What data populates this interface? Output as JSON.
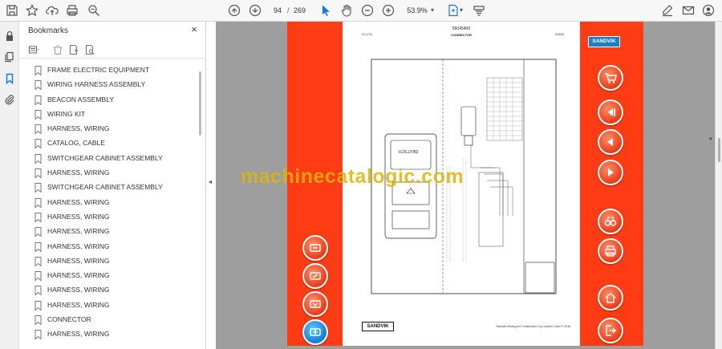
{
  "toolbar": {
    "page_current": "94",
    "page_separator": "/",
    "page_total": "269",
    "zoom": "53.9%"
  },
  "bookmarks": {
    "title": "Bookmarks",
    "close_glyph": "×",
    "items": [
      {
        "label": "FRAME ELECTRIC EQUIPMENT"
      },
      {
        "label": "WIRING HARNESS ASSEMBLY"
      },
      {
        "label": "BEACON ASSEMBLY"
      },
      {
        "label": "WIRING KIT"
      },
      {
        "label": "HARNESS, WIRING"
      },
      {
        "label": "CATALOG, CABLE"
      },
      {
        "label": "SWITCHGEAR CABINET ASSEMBLY"
      },
      {
        "label": "HARNESS, WIRING"
      },
      {
        "label": "SWITCHGEAR CABINET ASSEMBLY"
      },
      {
        "label": "HARNESS, WIRING"
      },
      {
        "label": "HARNESS, WIRING"
      },
      {
        "label": "HARNESS, WIRING"
      },
      {
        "label": "HARNESS, WIRING"
      },
      {
        "label": "HARNESS, WIRING"
      },
      {
        "label": "HARNESS, WIRING"
      },
      {
        "label": "HARNESS, WIRING"
      },
      {
        "label": "HARNESS, WIRING"
      },
      {
        "label": "CONNECTOR"
      },
      {
        "label": "HARNESS, WIRING"
      }
    ]
  },
  "document": {
    "sheet_number": "56045400",
    "sheet_subtitle": "CONNECTOR",
    "sheet_left_code": "01 (173)",
    "sheet_right_code": "102633",
    "sheet_footer": "Sandvik Mining and Construction Oy Loaders Turku © 2016",
    "sandvik_footer": "SANDVIK",
    "sandvik_logo": "SANDVIK",
    "connector_label": "DEUTSCH",
    "watermark": "machinecatalogic.com"
  },
  "colors": {
    "strip": "#ff3c14",
    "toolbar_active": "#1473e6",
    "watermark": "#dcb40a",
    "logo_blue": "#1a7fc7"
  }
}
